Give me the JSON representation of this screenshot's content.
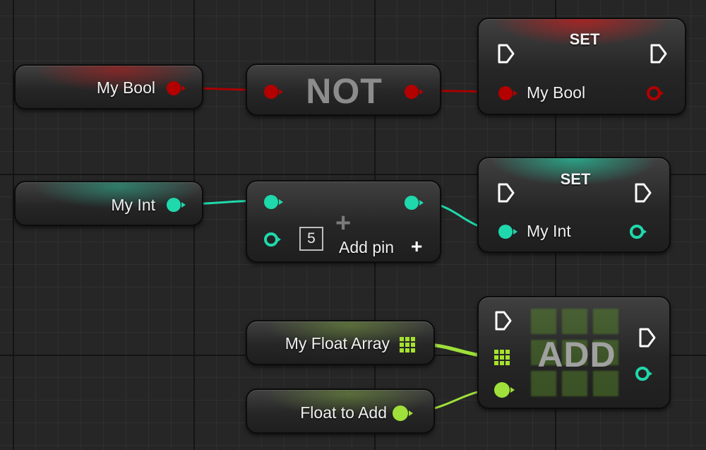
{
  "colors": {
    "bool": "#b30000",
    "int": "#1fd8ab",
    "float": "#9fe03a",
    "exec": "#ffffff"
  },
  "nodes": {
    "get_bool": {
      "label": "My Bool"
    },
    "not": {
      "title": "NOT"
    },
    "set_bool": {
      "title": "SET",
      "input_label": "My Bool"
    },
    "get_int": {
      "label": "My Int"
    },
    "add_int": {
      "default_value": "5",
      "add_pin_label": "Add pin"
    },
    "set_int": {
      "title": "SET",
      "input_label": "My Int"
    },
    "get_float_array": {
      "label": "My Float Array"
    },
    "float_to_add": {
      "label": "Float to Add"
    },
    "array_add": {
      "title": "ADD"
    }
  }
}
